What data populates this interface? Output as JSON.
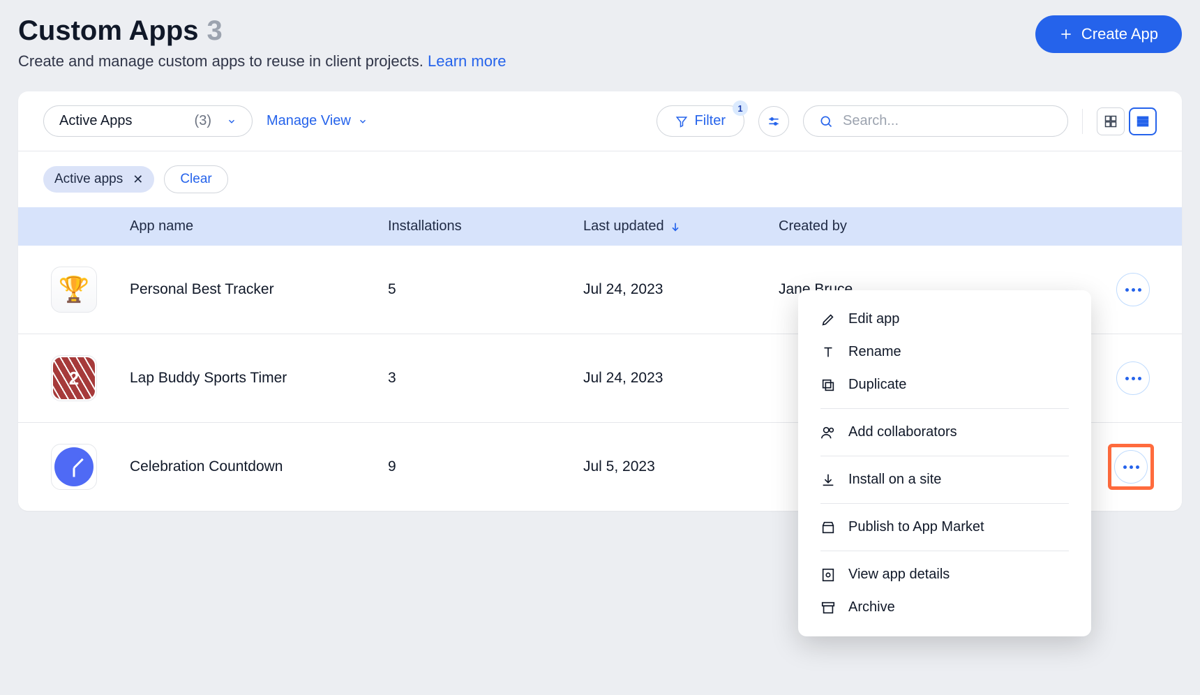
{
  "header": {
    "title": "Custom Apps",
    "count": "3",
    "subtitle": "Create and manage custom apps to reuse in client projects.",
    "learn_more": "Learn more",
    "create_button": "Create App"
  },
  "toolbar": {
    "view_name": "Active Apps",
    "view_count": "(3)",
    "manage_view": "Manage View",
    "filter": "Filter",
    "filter_badge": "1",
    "search_placeholder": "Search..."
  },
  "chips": {
    "active_apps": "Active apps",
    "clear": "Clear"
  },
  "columns": {
    "app_name": "App name",
    "installations": "Installations",
    "last_updated": "Last updated",
    "created_by": "Created by"
  },
  "rows": [
    {
      "name": "Personal Best Tracker",
      "installs": "5",
      "updated": "Jul 24, 2023",
      "creator": "Jane Bruce",
      "icon": "trophy"
    },
    {
      "name": "Lap Buddy Sports Timer",
      "installs": "3",
      "updated": "Jul 24, 2023",
      "creator": "",
      "icon": "track"
    },
    {
      "name": "Celebration Countdown",
      "installs": "9",
      "updated": "Jul 5, 2023",
      "creator": "",
      "icon": "clock"
    }
  ],
  "menu": {
    "edit": "Edit app",
    "rename": "Rename",
    "duplicate": "Duplicate",
    "collab": "Add collaborators",
    "install": "Install on a site",
    "publish": "Publish to App Market",
    "details": "View app details",
    "archive": "Archive"
  }
}
